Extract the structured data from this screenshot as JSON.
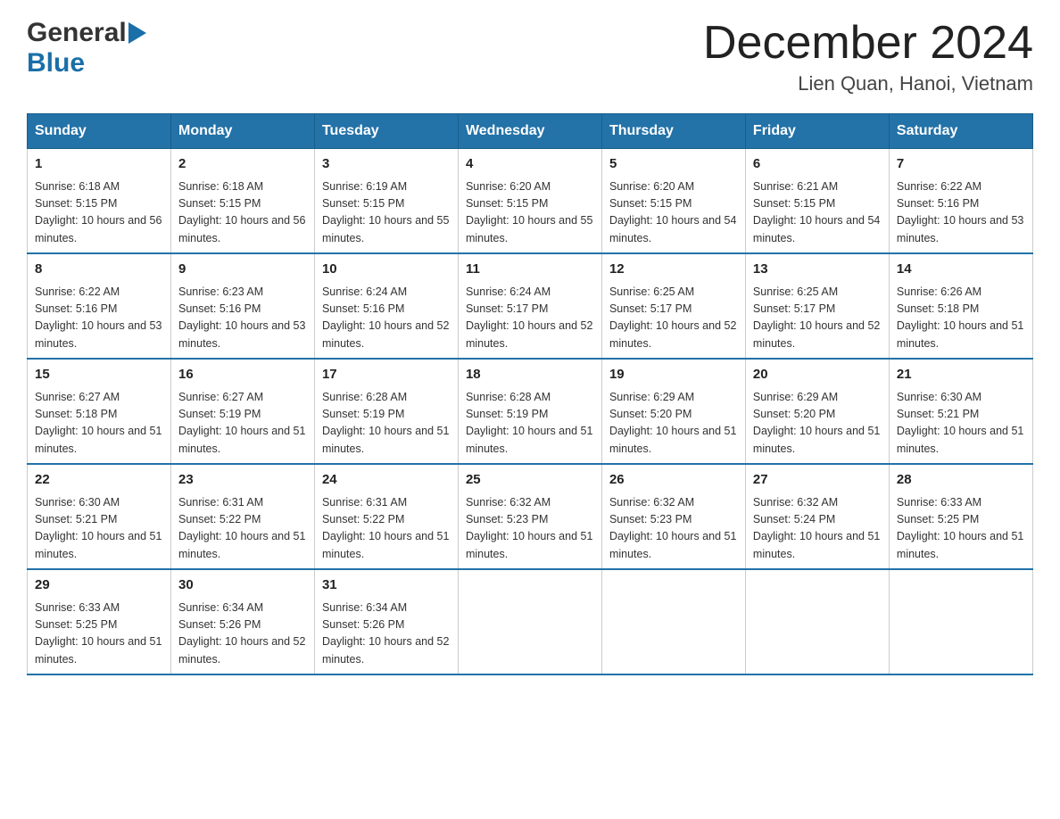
{
  "header": {
    "logo": {
      "general": "General",
      "blue": "Blue"
    },
    "title": "December 2024",
    "location": "Lien Quan, Hanoi, Vietnam"
  },
  "calendar": {
    "days_of_week": [
      "Sunday",
      "Monday",
      "Tuesday",
      "Wednesday",
      "Thursday",
      "Friday",
      "Saturday"
    ],
    "weeks": [
      [
        {
          "day": "1",
          "sunrise": "6:18 AM",
          "sunset": "5:15 PM",
          "daylight": "10 hours and 56 minutes."
        },
        {
          "day": "2",
          "sunrise": "6:18 AM",
          "sunset": "5:15 PM",
          "daylight": "10 hours and 56 minutes."
        },
        {
          "day": "3",
          "sunrise": "6:19 AM",
          "sunset": "5:15 PM",
          "daylight": "10 hours and 55 minutes."
        },
        {
          "day": "4",
          "sunrise": "6:20 AM",
          "sunset": "5:15 PM",
          "daylight": "10 hours and 55 minutes."
        },
        {
          "day": "5",
          "sunrise": "6:20 AM",
          "sunset": "5:15 PM",
          "daylight": "10 hours and 54 minutes."
        },
        {
          "day": "6",
          "sunrise": "6:21 AM",
          "sunset": "5:15 PM",
          "daylight": "10 hours and 54 minutes."
        },
        {
          "day": "7",
          "sunrise": "6:22 AM",
          "sunset": "5:16 PM",
          "daylight": "10 hours and 53 minutes."
        }
      ],
      [
        {
          "day": "8",
          "sunrise": "6:22 AM",
          "sunset": "5:16 PM",
          "daylight": "10 hours and 53 minutes."
        },
        {
          "day": "9",
          "sunrise": "6:23 AM",
          "sunset": "5:16 PM",
          "daylight": "10 hours and 53 minutes."
        },
        {
          "day": "10",
          "sunrise": "6:24 AM",
          "sunset": "5:16 PM",
          "daylight": "10 hours and 52 minutes."
        },
        {
          "day": "11",
          "sunrise": "6:24 AM",
          "sunset": "5:17 PM",
          "daylight": "10 hours and 52 minutes."
        },
        {
          "day": "12",
          "sunrise": "6:25 AM",
          "sunset": "5:17 PM",
          "daylight": "10 hours and 52 minutes."
        },
        {
          "day": "13",
          "sunrise": "6:25 AM",
          "sunset": "5:17 PM",
          "daylight": "10 hours and 52 minutes."
        },
        {
          "day": "14",
          "sunrise": "6:26 AM",
          "sunset": "5:18 PM",
          "daylight": "10 hours and 51 minutes."
        }
      ],
      [
        {
          "day": "15",
          "sunrise": "6:27 AM",
          "sunset": "5:18 PM",
          "daylight": "10 hours and 51 minutes."
        },
        {
          "day": "16",
          "sunrise": "6:27 AM",
          "sunset": "5:19 PM",
          "daylight": "10 hours and 51 minutes."
        },
        {
          "day": "17",
          "sunrise": "6:28 AM",
          "sunset": "5:19 PM",
          "daylight": "10 hours and 51 minutes."
        },
        {
          "day": "18",
          "sunrise": "6:28 AM",
          "sunset": "5:19 PM",
          "daylight": "10 hours and 51 minutes."
        },
        {
          "day": "19",
          "sunrise": "6:29 AM",
          "sunset": "5:20 PM",
          "daylight": "10 hours and 51 minutes."
        },
        {
          "day": "20",
          "sunrise": "6:29 AM",
          "sunset": "5:20 PM",
          "daylight": "10 hours and 51 minutes."
        },
        {
          "day": "21",
          "sunrise": "6:30 AM",
          "sunset": "5:21 PM",
          "daylight": "10 hours and 51 minutes."
        }
      ],
      [
        {
          "day": "22",
          "sunrise": "6:30 AM",
          "sunset": "5:21 PM",
          "daylight": "10 hours and 51 minutes."
        },
        {
          "day": "23",
          "sunrise": "6:31 AM",
          "sunset": "5:22 PM",
          "daylight": "10 hours and 51 minutes."
        },
        {
          "day": "24",
          "sunrise": "6:31 AM",
          "sunset": "5:22 PM",
          "daylight": "10 hours and 51 minutes."
        },
        {
          "day": "25",
          "sunrise": "6:32 AM",
          "sunset": "5:23 PM",
          "daylight": "10 hours and 51 minutes."
        },
        {
          "day": "26",
          "sunrise": "6:32 AM",
          "sunset": "5:23 PM",
          "daylight": "10 hours and 51 minutes."
        },
        {
          "day": "27",
          "sunrise": "6:32 AM",
          "sunset": "5:24 PM",
          "daylight": "10 hours and 51 minutes."
        },
        {
          "day": "28",
          "sunrise": "6:33 AM",
          "sunset": "5:25 PM",
          "daylight": "10 hours and 51 minutes."
        }
      ],
      [
        {
          "day": "29",
          "sunrise": "6:33 AM",
          "sunset": "5:25 PM",
          "daylight": "10 hours and 51 minutes."
        },
        {
          "day": "30",
          "sunrise": "6:34 AM",
          "sunset": "5:26 PM",
          "daylight": "10 hours and 52 minutes."
        },
        {
          "day": "31",
          "sunrise": "6:34 AM",
          "sunset": "5:26 PM",
          "daylight": "10 hours and 52 minutes."
        },
        null,
        null,
        null,
        null
      ]
    ]
  }
}
